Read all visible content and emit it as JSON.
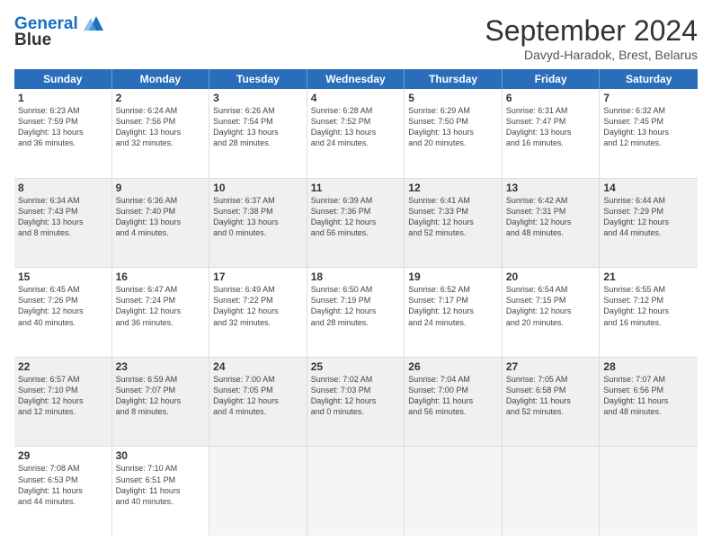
{
  "header": {
    "logo_line1": "General",
    "logo_line2": "Blue",
    "month": "September 2024",
    "location": "Davyd-Haradok, Brest, Belarus"
  },
  "days_of_week": [
    "Sunday",
    "Monday",
    "Tuesday",
    "Wednesday",
    "Thursday",
    "Friday",
    "Saturday"
  ],
  "weeks": [
    [
      {
        "day": 1,
        "shade": false,
        "lines": [
          "Sunrise: 6:23 AM",
          "Sunset: 7:59 PM",
          "Daylight: 13 hours",
          "and 36 minutes."
        ]
      },
      {
        "day": 2,
        "shade": false,
        "lines": [
          "Sunrise: 6:24 AM",
          "Sunset: 7:56 PM",
          "Daylight: 13 hours",
          "and 32 minutes."
        ]
      },
      {
        "day": 3,
        "shade": false,
        "lines": [
          "Sunrise: 6:26 AM",
          "Sunset: 7:54 PM",
          "Daylight: 13 hours",
          "and 28 minutes."
        ]
      },
      {
        "day": 4,
        "shade": false,
        "lines": [
          "Sunrise: 6:28 AM",
          "Sunset: 7:52 PM",
          "Daylight: 13 hours",
          "and 24 minutes."
        ]
      },
      {
        "day": 5,
        "shade": false,
        "lines": [
          "Sunrise: 6:29 AM",
          "Sunset: 7:50 PM",
          "Daylight: 13 hours",
          "and 20 minutes."
        ]
      },
      {
        "day": 6,
        "shade": false,
        "lines": [
          "Sunrise: 6:31 AM",
          "Sunset: 7:47 PM",
          "Daylight: 13 hours",
          "and 16 minutes."
        ]
      },
      {
        "day": 7,
        "shade": false,
        "lines": [
          "Sunrise: 6:32 AM",
          "Sunset: 7:45 PM",
          "Daylight: 13 hours",
          "and 12 minutes."
        ]
      }
    ],
    [
      {
        "day": 8,
        "shade": true,
        "lines": [
          "Sunrise: 6:34 AM",
          "Sunset: 7:43 PM",
          "Daylight: 13 hours",
          "and 8 minutes."
        ]
      },
      {
        "day": 9,
        "shade": true,
        "lines": [
          "Sunrise: 6:36 AM",
          "Sunset: 7:40 PM",
          "Daylight: 13 hours",
          "and 4 minutes."
        ]
      },
      {
        "day": 10,
        "shade": true,
        "lines": [
          "Sunrise: 6:37 AM",
          "Sunset: 7:38 PM",
          "Daylight: 13 hours",
          "and 0 minutes."
        ]
      },
      {
        "day": 11,
        "shade": true,
        "lines": [
          "Sunrise: 6:39 AM",
          "Sunset: 7:36 PM",
          "Daylight: 12 hours",
          "and 56 minutes."
        ]
      },
      {
        "day": 12,
        "shade": true,
        "lines": [
          "Sunrise: 6:41 AM",
          "Sunset: 7:33 PM",
          "Daylight: 12 hours",
          "and 52 minutes."
        ]
      },
      {
        "day": 13,
        "shade": true,
        "lines": [
          "Sunrise: 6:42 AM",
          "Sunset: 7:31 PM",
          "Daylight: 12 hours",
          "and 48 minutes."
        ]
      },
      {
        "day": 14,
        "shade": true,
        "lines": [
          "Sunrise: 6:44 AM",
          "Sunset: 7:29 PM",
          "Daylight: 12 hours",
          "and 44 minutes."
        ]
      }
    ],
    [
      {
        "day": 15,
        "shade": false,
        "lines": [
          "Sunrise: 6:45 AM",
          "Sunset: 7:26 PM",
          "Daylight: 12 hours",
          "and 40 minutes."
        ]
      },
      {
        "day": 16,
        "shade": false,
        "lines": [
          "Sunrise: 6:47 AM",
          "Sunset: 7:24 PM",
          "Daylight: 12 hours",
          "and 36 minutes."
        ]
      },
      {
        "day": 17,
        "shade": false,
        "lines": [
          "Sunrise: 6:49 AM",
          "Sunset: 7:22 PM",
          "Daylight: 12 hours",
          "and 32 minutes."
        ]
      },
      {
        "day": 18,
        "shade": false,
        "lines": [
          "Sunrise: 6:50 AM",
          "Sunset: 7:19 PM",
          "Daylight: 12 hours",
          "and 28 minutes."
        ]
      },
      {
        "day": 19,
        "shade": false,
        "lines": [
          "Sunrise: 6:52 AM",
          "Sunset: 7:17 PM",
          "Daylight: 12 hours",
          "and 24 minutes."
        ]
      },
      {
        "day": 20,
        "shade": false,
        "lines": [
          "Sunrise: 6:54 AM",
          "Sunset: 7:15 PM",
          "Daylight: 12 hours",
          "and 20 minutes."
        ]
      },
      {
        "day": 21,
        "shade": false,
        "lines": [
          "Sunrise: 6:55 AM",
          "Sunset: 7:12 PM",
          "Daylight: 12 hours",
          "and 16 minutes."
        ]
      }
    ],
    [
      {
        "day": 22,
        "shade": true,
        "lines": [
          "Sunrise: 6:57 AM",
          "Sunset: 7:10 PM",
          "Daylight: 12 hours",
          "and 12 minutes."
        ]
      },
      {
        "day": 23,
        "shade": true,
        "lines": [
          "Sunrise: 6:59 AM",
          "Sunset: 7:07 PM",
          "Daylight: 12 hours",
          "and 8 minutes."
        ]
      },
      {
        "day": 24,
        "shade": true,
        "lines": [
          "Sunrise: 7:00 AM",
          "Sunset: 7:05 PM",
          "Daylight: 12 hours",
          "and 4 minutes."
        ]
      },
      {
        "day": 25,
        "shade": true,
        "lines": [
          "Sunrise: 7:02 AM",
          "Sunset: 7:03 PM",
          "Daylight: 12 hours",
          "and 0 minutes."
        ]
      },
      {
        "day": 26,
        "shade": true,
        "lines": [
          "Sunrise: 7:04 AM",
          "Sunset: 7:00 PM",
          "Daylight: 11 hours",
          "and 56 minutes."
        ]
      },
      {
        "day": 27,
        "shade": true,
        "lines": [
          "Sunrise: 7:05 AM",
          "Sunset: 6:58 PM",
          "Daylight: 11 hours",
          "and 52 minutes."
        ]
      },
      {
        "day": 28,
        "shade": true,
        "lines": [
          "Sunrise: 7:07 AM",
          "Sunset: 6:56 PM",
          "Daylight: 11 hours",
          "and 48 minutes."
        ]
      }
    ],
    [
      {
        "day": 29,
        "shade": false,
        "lines": [
          "Sunrise: 7:08 AM",
          "Sunset: 6:53 PM",
          "Daylight: 11 hours",
          "and 44 minutes."
        ]
      },
      {
        "day": 30,
        "shade": false,
        "lines": [
          "Sunrise: 7:10 AM",
          "Sunset: 6:51 PM",
          "Daylight: 11 hours",
          "and 40 minutes."
        ]
      },
      {
        "day": null,
        "shade": false,
        "lines": []
      },
      {
        "day": null,
        "shade": false,
        "lines": []
      },
      {
        "day": null,
        "shade": false,
        "lines": []
      },
      {
        "day": null,
        "shade": false,
        "lines": []
      },
      {
        "day": null,
        "shade": false,
        "lines": []
      }
    ]
  ]
}
